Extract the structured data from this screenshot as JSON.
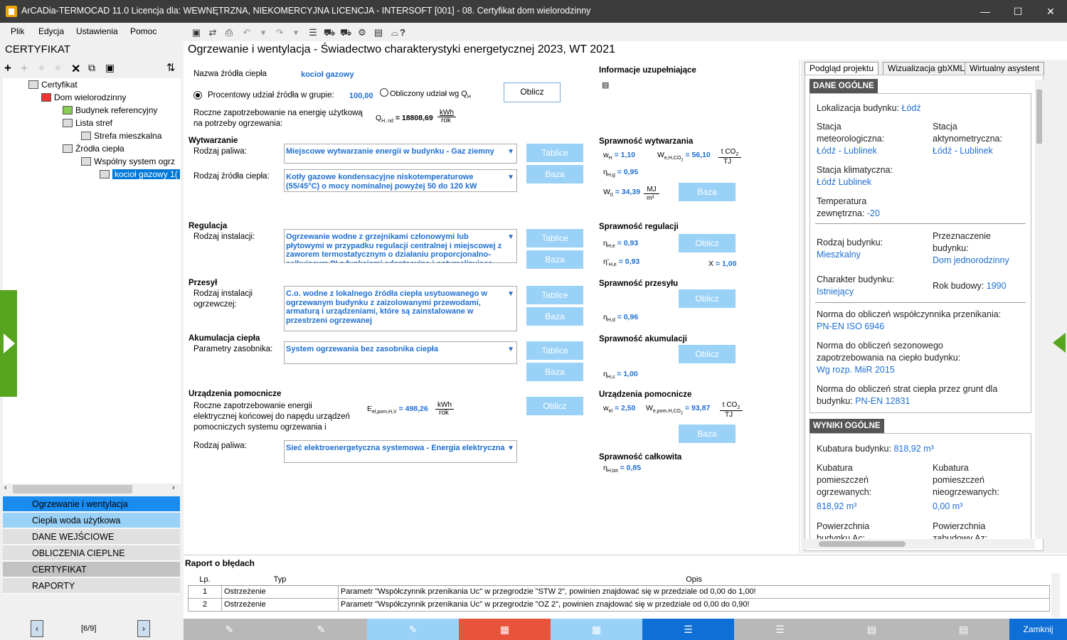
{
  "window": {
    "title": "ArCADia-TERMOCAD 11.0 Licencja dla: WEWNĘTRZNA, NIEKOMERCYJNA LICENCJA - INTERSOFT [001] - 08. Certyfikat dom wielorodzinny",
    "min": "—",
    "max": "☐",
    "close": "✕"
  },
  "menu": {
    "file": "Plik",
    "edit": "Edycja",
    "settings": "Ustawienia",
    "help": "Pomoc"
  },
  "left": {
    "section": "CERTYFIKAT",
    "tree": [
      "Certyfikat",
      "Dom wielorodzinny",
      "Budynek referencyjny",
      "Lista stref",
      "Strefa mieszkalna",
      "Źródła ciepła",
      "Wspólny system ogrz",
      "kocioł gazowy 1("
    ],
    "nav": [
      "Ogrzewanie i wentylacja",
      "Ciepła woda użytkowa",
      "DANE WEJŚCIOWE",
      "OBLICZENIA CIEPLNE",
      "CERTYFIKAT",
      "RAPORTY"
    ],
    "pager": "[6/9]"
  },
  "main": {
    "title": "Ogrzewanie i wentylacja - Świadectwo charakterystyki energetycznej 2023, WT 2021",
    "source_name_label": "Nazwa źródła ciepła",
    "source_name": "kocioł gazowy",
    "percent_label": "Procentowy udział źródła w grupie:",
    "percent_value": "100,00",
    "calc_share_label": "Obliczony udział wg Q",
    "calc_share_sub": "H",
    "calc_btn": "Oblicz",
    "annual_label1": "Roczne zapotrzebowanie na energię użytkową",
    "annual_label2": "na potrzeby ogrzewania:",
    "qhnd_sym": "Q",
    "qhnd_sub": "H, nd",
    "qhnd_val": "= 18808,69",
    "qhnd_unit_top": "kWh",
    "qhnd_unit_bot": "rok",
    "info_label": "Informacje uzupełniające",
    "gen_head": "Wytwarzanie",
    "fuel_label": "Rodzaj paliwa:",
    "fuel_value": "Miejscowe wytwarzanie energii w budynku - Gaz ziemny",
    "src_label": "Rodzaj źródła ciepła:",
    "src_value": "Kotły gazowe kondensacyjne niskotemperaturowe (55/45°C) o mocy nominalnej powyżej 50 do 120 kW",
    "reg_head": "Regulacja",
    "inst_label": "Rodzaj instalacji:",
    "inst_value": "Ogrzewanie wodne z grzejnikami członowymi lub płytowymi w przypadku regulacji centralnej i miejscowej z zaworem termostatycznym o działaniu proporcjonalno-całkującym PI z funkcjami adaptacyjną i optymalizującą",
    "trans_head": "Przesył",
    "trans_label1": "Rodzaj instalacji",
    "trans_label2": "ogrzewczej:",
    "trans_value": "C.o. wodne z lokalnego źródła ciepła usytuowanego w ogrzewanym budynku z zaizolowanymi przewodami, armaturą i urządzeniami, które są zainstalowane w przestrzeni ogrzewanej",
    "acc_head": "Akumulacja ciepła",
    "acc_label": "Parametry zasobnika:",
    "acc_value": "System ogrzewania bez zasobnika ciepła",
    "aux_head": "Urządzenia pomocnicze",
    "aux_l1": "Roczne zapotrzebowanie energii",
    "aux_l2": "elektrycznej końcowej do napędu urządzeń",
    "aux_l3": "pomocniczych systemu ogrzewania i",
    "eel_sym": "E",
    "eel_sub": "el,pom,H,V",
    "eel_val": "= 498,26",
    "eel_unit_top": "kWh",
    "eel_unit_bot": "rok",
    "aux_fuel_label": "Rodzaj paliwa:",
    "aux_fuel_value": "Sieć elektroenergetyczna systemowa - Energia elektryczna",
    "btn_tables": "Tablice",
    "btn_base": "Baza",
    "btn_calc": "Oblicz",
    "eff_gen": "Sprawność wytwarzania",
    "wH": "w",
    "wH_sub": "H",
    "wH_val": "= 1,10",
    "weH": "W",
    "weH_sub": "e,H,CO",
    "weH_sub2": "2",
    "weH_val": "= 56,10",
    "unit_tco2": "t CO",
    "unit_tco2_sub": "2",
    "unit_tj": "TJ",
    "etaHg": "η",
    "etaHg_sub": "H,g",
    "etaHg_val": "= 0,95",
    "w0": "W",
    "w0_sub": "0",
    "w0_val": "= 34,39",
    "w0_unit_top": "MJ",
    "w0_unit_bot": "m³",
    "eff_reg": "Sprawność regulacji",
    "etaHe": "η",
    "etaHe_sub": "H,e",
    "etaHe_val": "= 0,93",
    "etaHe2": "η'",
    "etaHe2_sub": "H,e",
    "etaHe2_val": "= 0,93",
    "x_label": "X",
    "x_val": "= 1,00",
    "eff_trans": "Sprawność przesyłu",
    "etaHd": "η",
    "etaHd_sub": "H,d",
    "etaHd_val": "= 0,96",
    "eff_acc": "Sprawność akumulacji",
    "etaHs": "η",
    "etaHs_sub": "H,s",
    "etaHs_val": "= 1,00",
    "aux_dev": "Urządzenia pomocnicze",
    "wel": "w",
    "wel_sub": "el",
    "wel_val": "= 2,50",
    "wepom": "W",
    "wepom_sub": "e,pom,H,CO",
    "wepom_sub2": "2",
    "wepom_val": "= 93,87",
    "unit_tj2": "TJ",
    "eff_total": "Sprawność całkowita",
    "etaHtot": "η",
    "etaHtot_sub": "H,tot",
    "etaHtot_val": "= 0,85"
  },
  "right": {
    "tabs": [
      "Podgląd projektu",
      "Wizualizacja gbXML",
      "Wirtualny asystent"
    ],
    "general": "DANE OGÓLNE",
    "loc_label": "Lokalizacja budynku:",
    "loc": "Łódź",
    "met_label1": "Stacja",
    "met_label2": "meteorologiczna:",
    "met": "Łódź - Lublinek",
    "act_label1": "Stacja",
    "act_label2": "aktynometryczna:",
    "act": "Łódź - Lublinek",
    "clim_label": "Stacja klimatyczna:",
    "clim": "Łódź Lublinek",
    "temp_label1": "Temperatura",
    "temp_label2": "zewnętrzna:",
    "temp": "-20",
    "type_label": "Rodzaj budynku:",
    "type": "Mieszkalny",
    "purp_label1": "Przeznaczenie",
    "purp_label2": "budynku:",
    "purp": "Dom jednorodzinny",
    "char_label": "Charakter budynku:",
    "char": "Istniejący",
    "year_label": "Rok budowy:",
    "year": "1990",
    "norm1_label": "Norma do obliczeń współczynnika przenikania:",
    "norm1": "PN-EN ISO 6946",
    "norm2_label1": "Norma do obliczeń sezonowego",
    "norm2_label2": "zapotrzebowania na ciepło budynku:",
    "norm2": "Wg rozp. MiiR 2015",
    "norm3_label1": "Norma do obliczeń strat ciepła przez grunt dla",
    "norm3_label2": "budynku:",
    "norm3": "PN-EN 12831",
    "results": "WYNIKI OGÓLNE",
    "vol_label": "Kubatura budynku:",
    "vol": "818,92 m³",
    "vh_l1": "Kubatura",
    "vh_l2": "pomieszczeń",
    "vh_l3": "ogrzewanych:",
    "vh": "818,92 m³",
    "vn_l1": "Kubatura",
    "vn_l2": "pomieszczeń",
    "vn_l3": "nieogrzewanych:",
    "vn": "0,00 m³",
    "area1_l1": "Powierzchnia",
    "area1_l2": "budynku Ac:",
    "area2_l1": "Powierzchnia",
    "area2_l2": "zabudowy Az:"
  },
  "report": {
    "title": "Raport o błędach",
    "cols": [
      "Lp.",
      "Typ",
      "Opis"
    ],
    "rows": [
      [
        "1",
        "Ostrzeżenie",
        "Parametr \"Współczynnik przenikania Uc\" w przegrodzie \"STW 2\", powinien znajdować się w przedziale od 0,00 do 1,00!"
      ],
      [
        "2",
        "Ostrzeżenie",
        "Parametr \"Współczynnik przenikania Uc\" w przegrodzie \"OZ 2\", powinien znajdować się w przedziale od 0,00 do 0,90!"
      ]
    ]
  },
  "bottom": {
    "close": "Zamknij"
  },
  "colors": {
    "accent": "#0078d7",
    "light_blue": "#99d1f7",
    "red_tab": "#e8533b",
    "green": "#57a41e",
    "nav_selected": "#1a8cf0"
  }
}
